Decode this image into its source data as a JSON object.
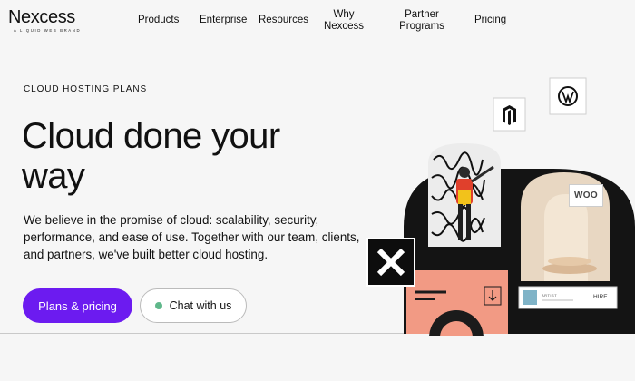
{
  "brand": {
    "name": "Nexcess",
    "tagline": "A LIQUID WEB BRAND"
  },
  "nav": {
    "products": "Products",
    "enterprise": "Enterprise",
    "resources": "Resources",
    "why_line1": "Why",
    "why_line2": "Nexcess",
    "partner_line1": "Partner",
    "partner_line2": "Programs",
    "pricing": "Pricing"
  },
  "hero": {
    "eyebrow": "CLOUD HOSTING PLANS",
    "title": "Cloud done your way",
    "description": "We believe in the promise of cloud: scalability, security, performance, and ease of use. Together with our team, clients, and partners, we've built better cloud hosting.",
    "primary_button": "Plans & pricing",
    "chat_button": "Chat with us"
  },
  "illustration": {
    "woo_badge": "WOO",
    "artist_label": "ARTIST",
    "hire_label": "HIRE",
    "icons": [
      "magento-icon",
      "wordpress-icon",
      "woocommerce-icon",
      "x-icon",
      "arrow-down-icon"
    ]
  },
  "colors": {
    "accent": "#6c1bf0",
    "chat_dot": "#5fb78a",
    "background": "#f6f6f6"
  }
}
